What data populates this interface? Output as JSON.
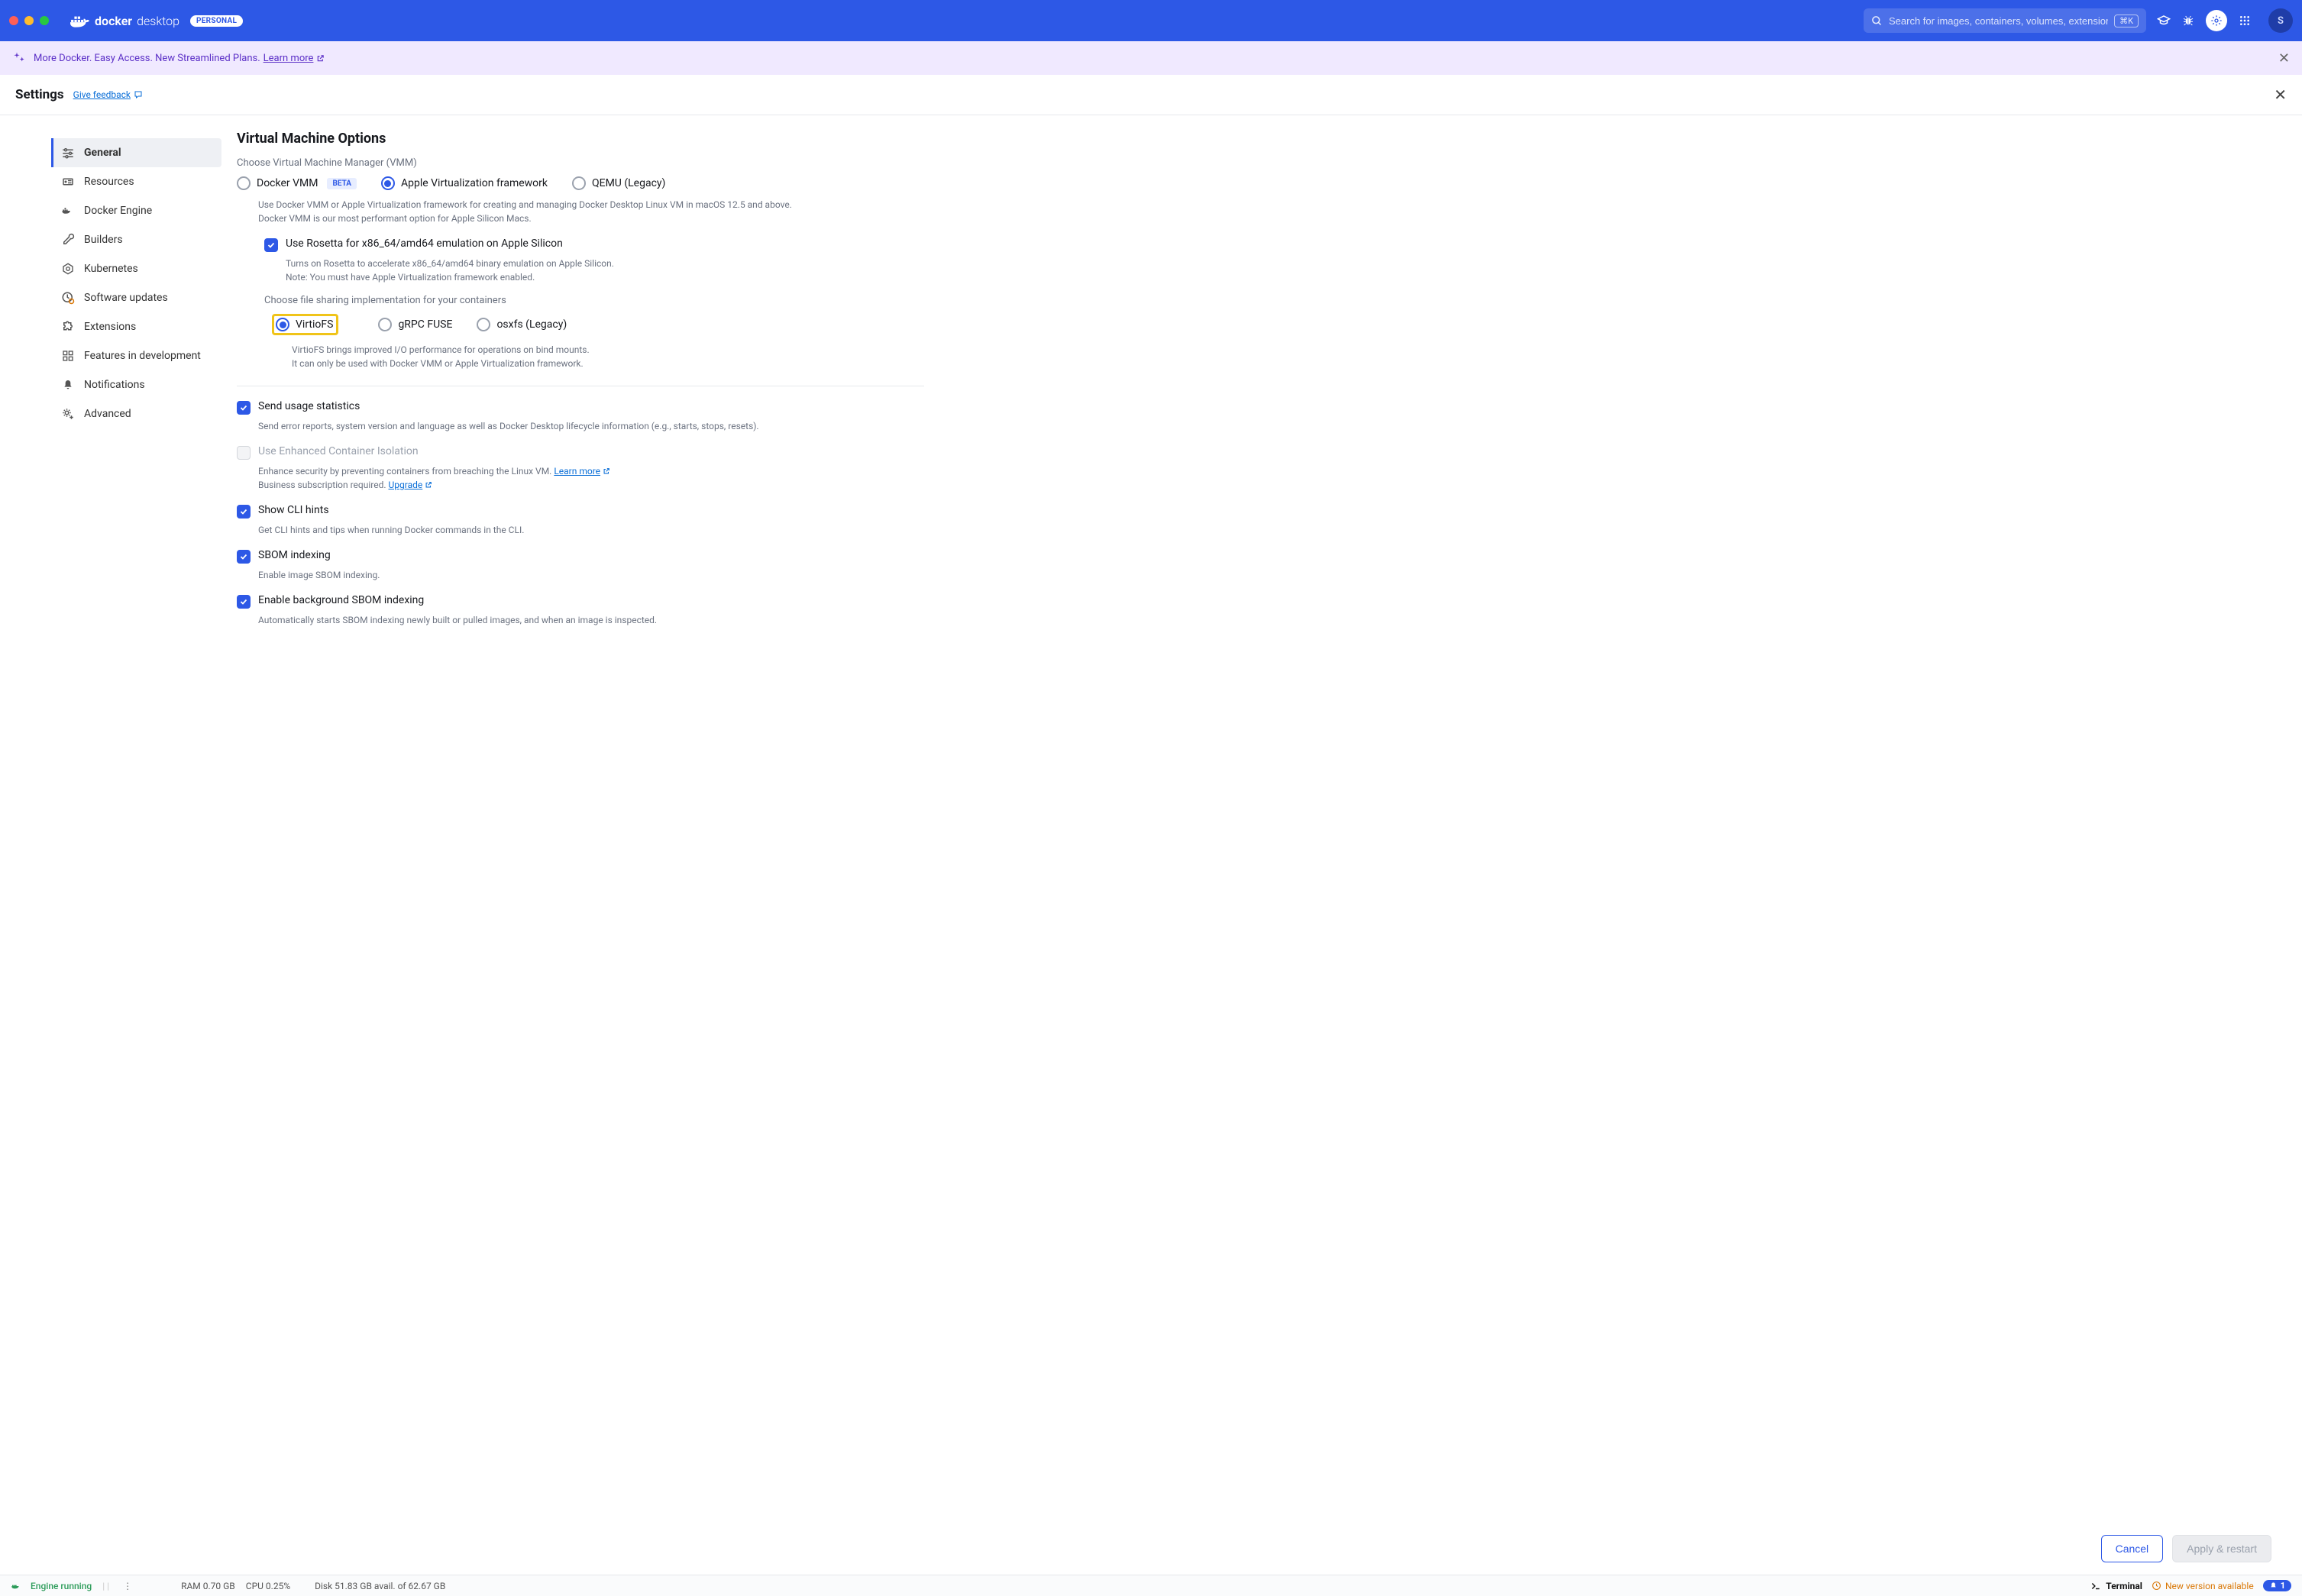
{
  "topbar": {
    "product": "docker",
    "product2": "desktop",
    "plan_badge": "PERSONAL",
    "search_placeholder": "Search for images, containers, volumes, extensions …",
    "kbd": "⌘K",
    "avatar_initial": "S"
  },
  "banner": {
    "text": "More Docker. Easy Access. New Streamlined Plans. ",
    "link": "Learn more"
  },
  "settings": {
    "title": "Settings",
    "feedback": "Give feedback"
  },
  "sidebar": {
    "items": [
      {
        "label": "General"
      },
      {
        "label": "Resources"
      },
      {
        "label": "Docker Engine"
      },
      {
        "label": "Builders"
      },
      {
        "label": "Kubernetes"
      },
      {
        "label": "Software updates"
      },
      {
        "label": "Extensions"
      },
      {
        "label": "Features in development"
      },
      {
        "label": "Notifications"
      },
      {
        "label": "Advanced"
      }
    ]
  },
  "vm": {
    "heading": "Virtual Machine Options",
    "choose_vmm": "Choose Virtual Machine Manager (VMM)",
    "vmm_options": {
      "docker_vmm": "Docker VMM",
      "beta": "BETA",
      "apple": "Apple Virtualization framework",
      "qemu": "QEMU (Legacy)"
    },
    "vmm_help1": "Use Docker VMM or Apple Virtualization framework for creating and managing Docker Desktop Linux VM in macOS 12.5 and above.",
    "vmm_help2": "Docker VMM is our most performant option for Apple Silicon Macs.",
    "rosetta_label": "Use Rosetta for x86_64/amd64 emulation on Apple Silicon",
    "rosetta_help1": "Turns on Rosetta to accelerate x86_64/amd64 binary emulation on Apple Silicon.",
    "rosetta_help2": "Note: You must have Apple Virtualization framework enabled.",
    "fs_heading": "Choose file sharing implementation for your containers",
    "fs_options": {
      "virtiofs": "VirtioFS",
      "grpc": "gRPC FUSE",
      "osxfs": "osxfs (Legacy)"
    },
    "fs_help1": "VirtioFS brings improved I/O performance for operations on bind mounts.",
    "fs_help2": "It can only be used with Docker VMM or Apple Virtualization framework."
  },
  "checks": {
    "usage_label": "Send usage statistics",
    "usage_help": "Send error reports, system version and language as well as Docker Desktop lifecycle information (e.g., starts, stops, resets).",
    "eci_label": "Use Enhanced Container Isolation",
    "eci_help1": "Enhance security by preventing containers from breaching the Linux VM. ",
    "eci_learn": "Learn more",
    "eci_help2": "Business subscription required. ",
    "eci_upgrade": "Upgrade",
    "cli_label": "Show CLI hints",
    "cli_help": "Get CLI hints and tips when running Docker commands in the CLI.",
    "sbom_label": "SBOM indexing",
    "sbom_help": "Enable image SBOM indexing.",
    "bgsbom_label": "Enable background SBOM indexing",
    "bgsbom_help": "Automatically starts SBOM indexing newly built or pulled images, and when an image is inspected."
  },
  "buttons": {
    "cancel": "Cancel",
    "apply": "Apply & restart"
  },
  "status": {
    "engine": "Engine running",
    "ram": "RAM 0.70 GB",
    "cpu": "CPU 0.25%",
    "disk": "Disk 51.83 GB avail. of 62.67 GB",
    "terminal": "Terminal",
    "newver": "New version available",
    "bell_count": "1"
  }
}
